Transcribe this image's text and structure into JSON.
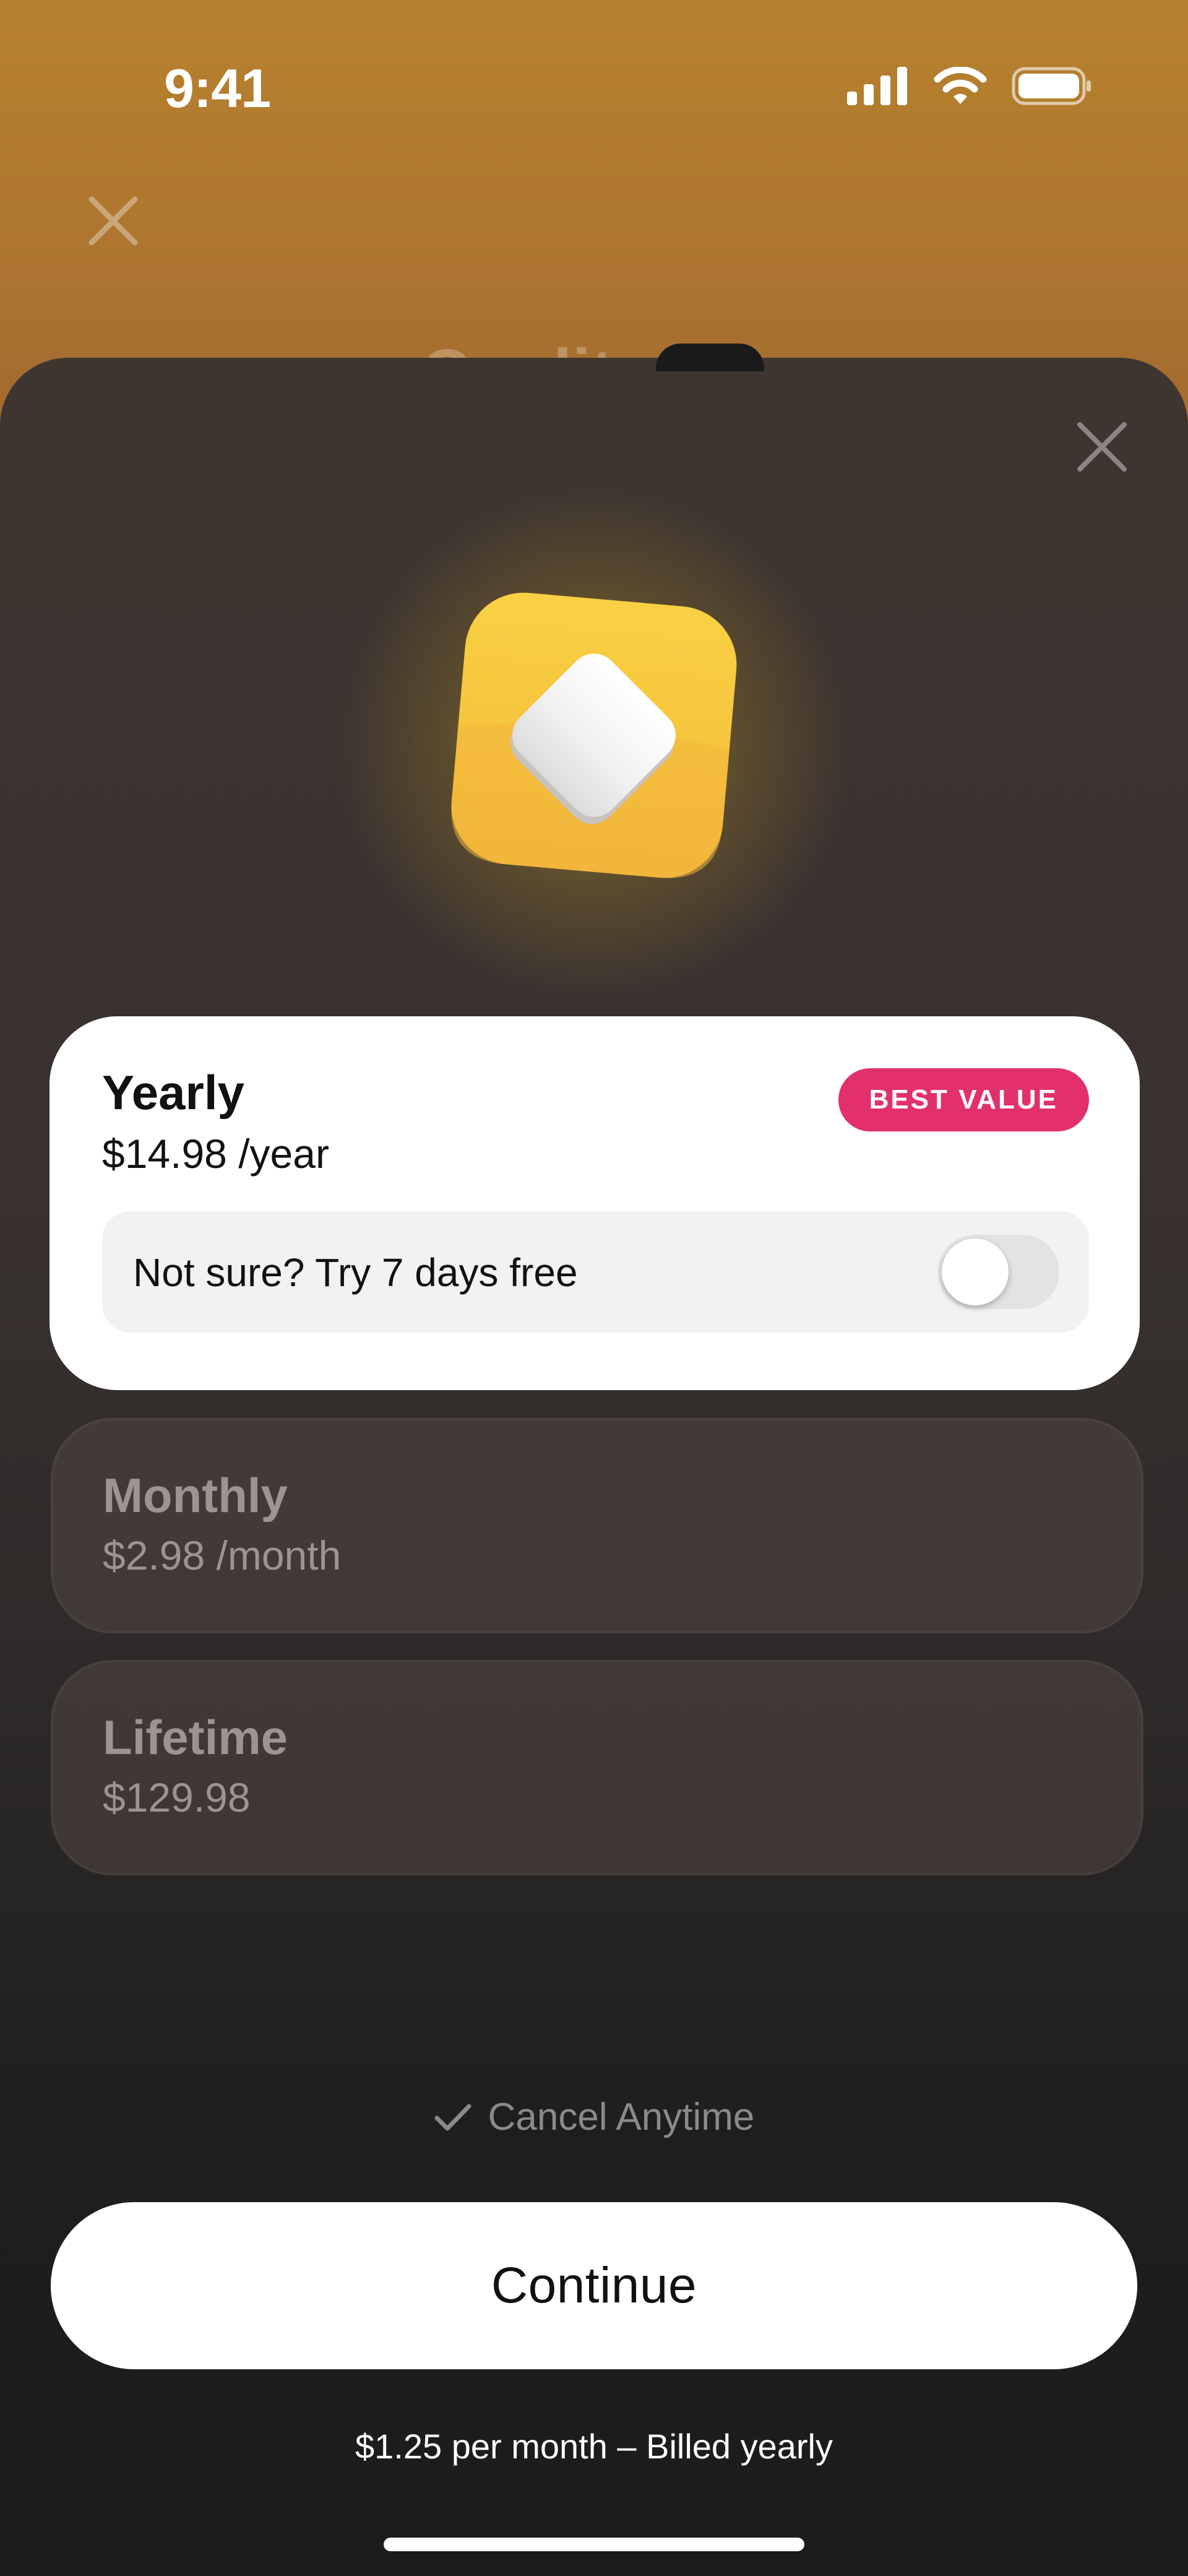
{
  "status_bar": {
    "time": "9:41"
  },
  "background": {
    "title_ghost": "Quality"
  },
  "plans": {
    "yearly": {
      "name": "Yearly",
      "price": "$14.98 /year",
      "badge": "BEST VALUE",
      "trial_label": "Not sure? Try 7 days free",
      "trial_enabled": false
    },
    "monthly": {
      "name": "Monthly",
      "price": "$2.98 /month"
    },
    "lifetime": {
      "name": "Lifetime",
      "price": "$129.98"
    }
  },
  "footer": {
    "cancel_label": "Cancel Anytime",
    "continue_label": "Continue",
    "billing_note": "$1.25 per month – Billed yearly"
  },
  "colors": {
    "badge": "#e2306f",
    "accent_icon": "#f4c23a",
    "background_top": "#b07a2a"
  },
  "icons": [
    "cellular-signal-icon",
    "wifi-icon",
    "battery-icon",
    "close-icon",
    "app-logo-icon",
    "checkmark-icon"
  ]
}
